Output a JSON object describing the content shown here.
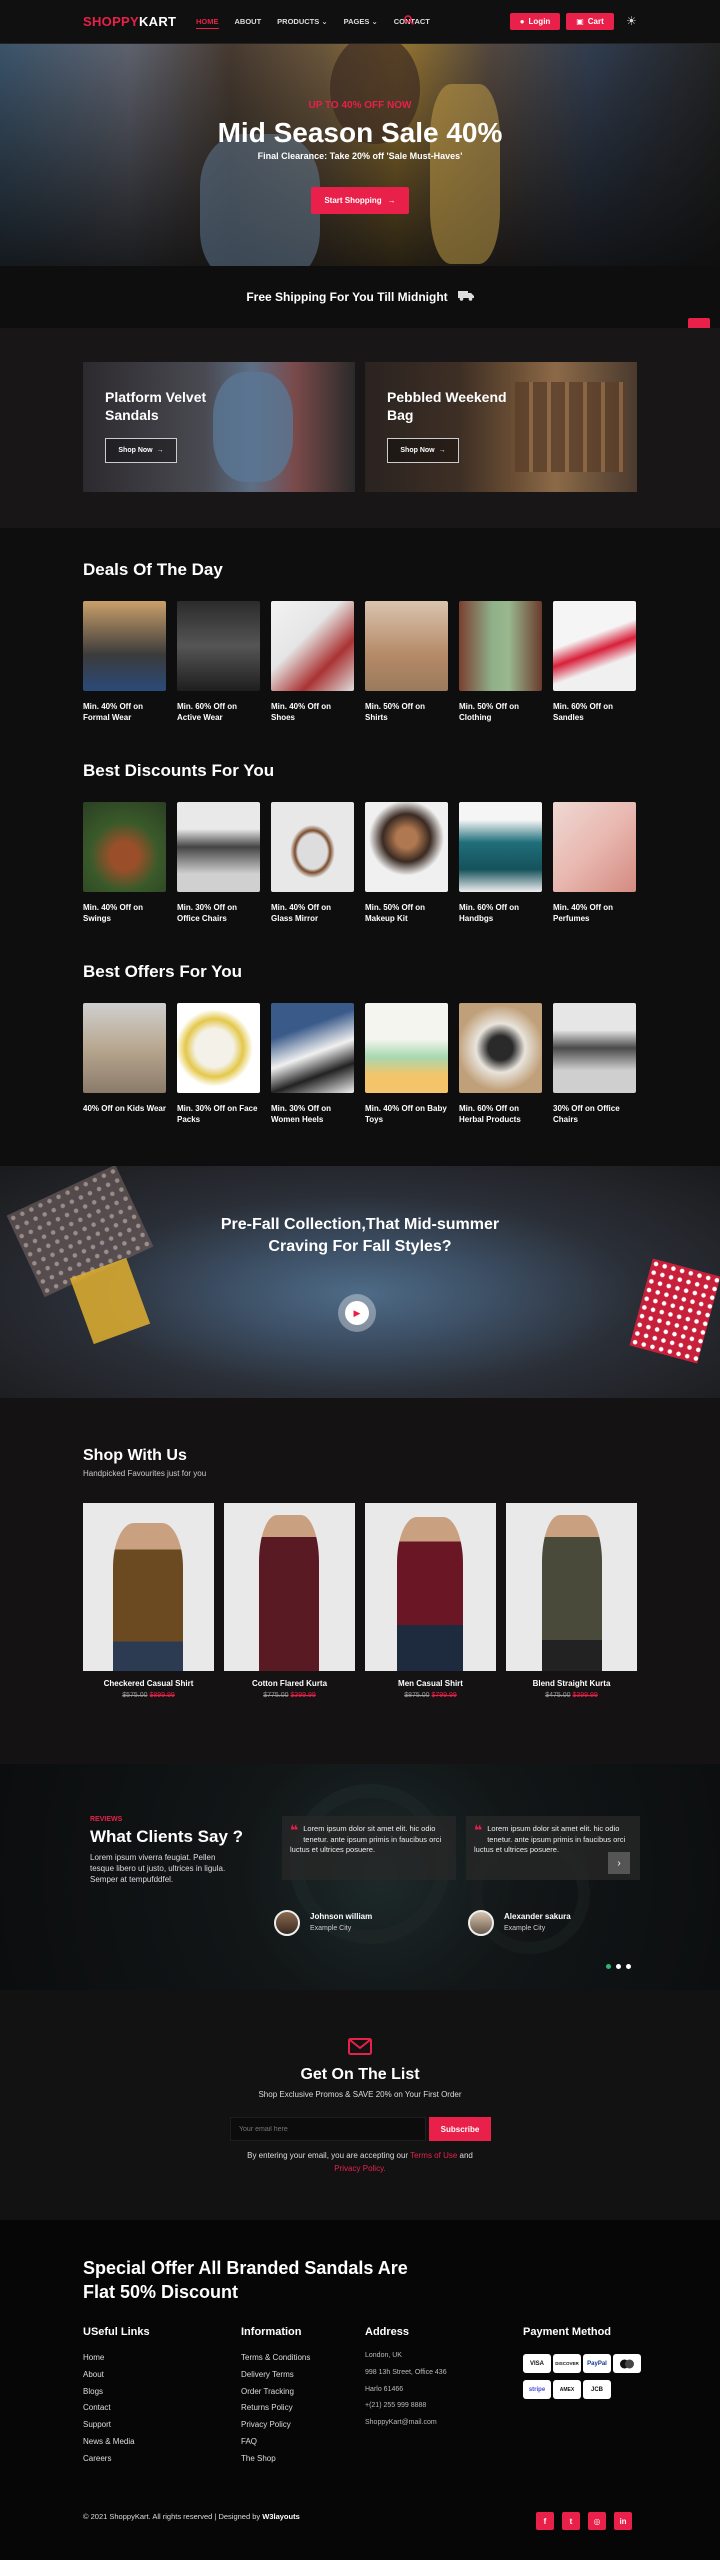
{
  "header": {
    "logo_a": "SHOPPY",
    "logo_b": "KART",
    "nav": [
      "HOME",
      "ABOUT",
      "PRODUCTS",
      "PAGES",
      "CONTACT"
    ],
    "login_label": "Login",
    "cart_label": "Cart"
  },
  "hero": {
    "subtitle": "UP TO 40% OFF NOW",
    "title": "Mid Season Sale 40%",
    "desc": "Final Clearance: Take 20% off 'Sale Must-Haves'",
    "button": "Start Shopping"
  },
  "shipping": {
    "text": "Free Shipping For You Till Midnight"
  },
  "promos": [
    {
      "title": "Platform Velvet Sandals",
      "button": "Shop Now"
    },
    {
      "title": "Pebbled Weekend Bag",
      "button": "Shop Now"
    }
  ],
  "deals": {
    "title": "Deals Of The Day",
    "items": [
      {
        "label": "Min. 40% Off on Formal Wear"
      },
      {
        "label": "Min. 60% Off on Active Wear"
      },
      {
        "label": "Min. 40% Off on Shoes"
      },
      {
        "label": "Min. 50% Off on Shirts"
      },
      {
        "label": "Min. 50% Off on Clothing"
      },
      {
        "label": "Min. 60% Off on Sandles"
      }
    ]
  },
  "discounts": {
    "title": "Best Discounts For You",
    "items": [
      {
        "label": "Min. 40% Off on Swings"
      },
      {
        "label": "Min. 30% Off on Office Chairs"
      },
      {
        "label": "Min. 40% Off on Glass Mirror"
      },
      {
        "label": "Min. 50% Off on Makeup Kit"
      },
      {
        "label": "Min. 60% Off on Handbgs"
      },
      {
        "label": "Min. 40% Off on Perfumes"
      }
    ]
  },
  "offers": {
    "title": "Best Offers For You",
    "items": [
      {
        "label": "40% Off on Kids Wear"
      },
      {
        "label": "Min. 30% Off on Face Packs"
      },
      {
        "label": "Min. 30% Off on Women Heels"
      },
      {
        "label": "Min. 40% Off on Baby Toys"
      },
      {
        "label": "Min. 60% Off on Herbal Products"
      },
      {
        "label": "30% Off on Office Chairs"
      }
    ]
  },
  "video": {
    "title_line1": "Pre-Fall Collection,That Mid-summer",
    "title_line2": "Craving For Fall Styles?"
  },
  "shop": {
    "title": "Shop With Us",
    "subtitle": "Handpicked Favourites just for you",
    "items": [
      {
        "name": "Checkered Casual Shirt",
        "old": "$575.00",
        "sale": "$899.99"
      },
      {
        "name": "Cotton Flared Kurta",
        "old": "$775.00",
        "sale": "$399.99"
      },
      {
        "name": "Men Casual Shirt",
        "old": "$875.00",
        "sale": "$799.99"
      },
      {
        "name": "Blend Straight Kurta",
        "old": "$475.00",
        "sale": "$399.99"
      }
    ]
  },
  "testimonials": {
    "tag": "REVIEWS",
    "title": "What Clients Say ?",
    "desc": "Lorem ipsum viverra feugiat. Pellen tesque libero ut justo, ultrices in ligula. Semper at tempufddfel.",
    "items": [
      {
        "quote": "Lorem ipsum dolor sit amet elit. hic odio tenetur. ante ipsum primis in faucibus orci luctus et ultrices posuere.",
        "name": "Johnson william",
        "city": "Example City"
      },
      {
        "quote": "Lorem ipsum dolor sit amet elit. hic odio tenetur. ante ipsum primis in faucibus orci luctus et ultrices posuere.",
        "name": "Alexander sakura",
        "city": "Example City"
      }
    ]
  },
  "newsletter": {
    "title": "Get On The List",
    "subtitle": "Shop Exclusive Promos & SAVE 20% on Your First Order",
    "placeholder": "Your email here",
    "button": "Subscribe",
    "terms_a": "By entering your email, you are accepting our ",
    "terms_link": "Terms of Use",
    "terms_b": " and",
    "privacy": "Privacy Policy."
  },
  "footer": {
    "offer_line1": "Special Offer All Branded Sandals Are",
    "offer_line2": "Flat 50% Discount",
    "useful_title": "USeful Links",
    "useful": [
      "Home",
      "About",
      "Blogs",
      "Contact",
      "Support",
      "News & Media",
      "Careers"
    ],
    "info_title": "Information",
    "info": [
      "Terms & Conditions",
      "Delivery Terms",
      "Order Tracking",
      "Returns Policy",
      "Privacy Policy",
      "FAQ",
      "The Shop"
    ],
    "address_title": "Address",
    "address": [
      "London, UK",
      "998 13h Street, Office 436",
      "Harlo 61466",
      "+(21) 255 999 8888",
      "ShoppyKart@mail.com"
    ],
    "payment_title": "Payment Method",
    "payment": [
      "VISA",
      "DISCOVER",
      "PayPal",
      "MC",
      "stripe",
      "AMEX",
      "JCB"
    ],
    "copyright_a": "© 2021 ShoppyKart. All rights reserved | Designed by ",
    "copyright_b": "W3layouts"
  },
  "colors": {
    "accent": "#e8204a",
    "background": "#141213",
    "footer": "#060606"
  }
}
